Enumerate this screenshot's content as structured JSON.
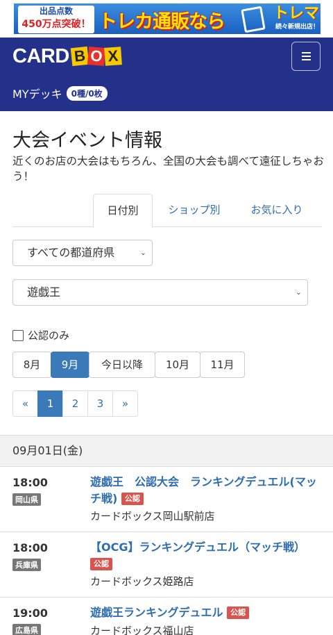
{
  "banner": {
    "left_line1": "出品点数",
    "left_line2": "450万点突破！",
    "middle": "トレカ通販なら",
    "right_name": "トレマ",
    "right_sub": "続々新規出店！"
  },
  "header": {
    "logo_word1": "CARD",
    "logo_letters": [
      "B",
      "O",
      "X"
    ],
    "mydeck_label": "MYデッキ",
    "mydeck_count": "0種/0枚",
    "colors": {
      "navy": "#23318a",
      "logo_yellow": "#f5c800",
      "logo_red": "#e8312c"
    }
  },
  "page": {
    "title": "大会イベント情報",
    "description": "近くのお店の大会はもちろん、全国の大会も調べて遠征しちゃおう！"
  },
  "tabs": [
    {
      "label": "日付別",
      "active": true
    },
    {
      "label": "ショップ別",
      "active": false
    },
    {
      "label": "お気に入り",
      "active": false
    }
  ],
  "filters": {
    "prefecture": "すべての都道府県",
    "game": "遊戯王",
    "official_only_label": "公認のみ",
    "official_only_checked": false
  },
  "months": [
    {
      "label": "8月",
      "active": false
    },
    {
      "label": "9月",
      "active": true
    },
    {
      "label": "今日以降",
      "active": false
    },
    {
      "label": "10月",
      "active": false
    },
    {
      "label": "11月",
      "active": false
    }
  ],
  "pagination": {
    "prev": "«",
    "pages": [
      "1",
      "2",
      "3"
    ],
    "current": "1",
    "next": "»"
  },
  "date_header": "09月01日(金)",
  "events": [
    {
      "time": "18:00",
      "prefecture": "岡山県",
      "title": "遊戯王　公認大会　ランキングデュエル(マッチ戦)",
      "badge": "公認",
      "shop": "カードボックス岡山駅前店"
    },
    {
      "time": "18:00",
      "prefecture": "兵庫県",
      "title": "【OCG】ランキングデュエル（マッチ戦）",
      "badge": "公認",
      "shop": "カードボックス姫路店"
    },
    {
      "time": "19:00",
      "prefecture": "広島県",
      "title": "遊戯王ランキングデュエル",
      "badge": "公認",
      "shop": "カードボックス福山店"
    }
  ]
}
